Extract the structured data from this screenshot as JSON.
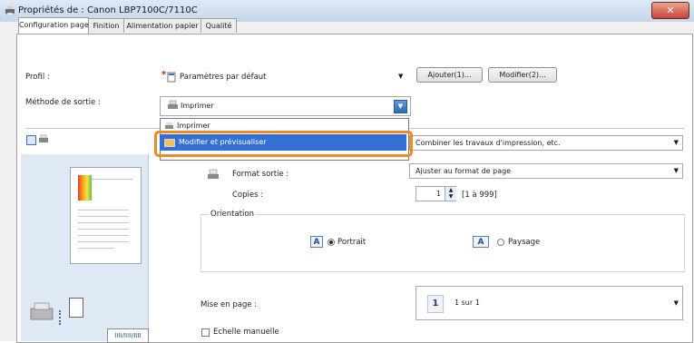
{
  "window": {
    "title": "Propriétés de : Canon LBP7100C/7110C",
    "close_glyph": "✕"
  },
  "tabs": [
    {
      "label": "Configuration page",
      "active": true
    },
    {
      "label": "Finition",
      "active": false
    },
    {
      "label": "Alimentation papier",
      "active": false
    },
    {
      "label": "Qualité",
      "active": false
    }
  ],
  "profile": {
    "label": "Profil :",
    "value": "Paramètres par défaut",
    "add_button": "Ajouter(1)...",
    "modify_button": "Modifier(2)..."
  },
  "output_method": {
    "label": "Méthode de sortie :",
    "value": "Imprimer",
    "options": [
      "Imprimer",
      "Modifier et prévisualiser"
    ],
    "highlighted_option": "Modifier et prévisualiser"
  },
  "combine_combo": {
    "value": "Combiner les travaux d'impression, etc."
  },
  "output_format": {
    "label": "Format sortie :",
    "value": "Ajuster au format de page"
  },
  "copies": {
    "label": "Copies :",
    "value": "1",
    "range": "[1 à 999]"
  },
  "orientation": {
    "label": "Orientation",
    "portrait": "Portrait",
    "landscape": "Paysage",
    "selected": "portrait",
    "icon_letter": "A"
  },
  "layout": {
    "label": "Mise en page :",
    "badge": "1",
    "value": "1 sur 1"
  },
  "manual_scale": {
    "label": "Echelle manuelle",
    "checked": false
  },
  "preview_label": "IIII/IIII/IIII",
  "colors": {
    "accent_highlight": "#3370d4",
    "highlight_outline": "#f08a24"
  }
}
